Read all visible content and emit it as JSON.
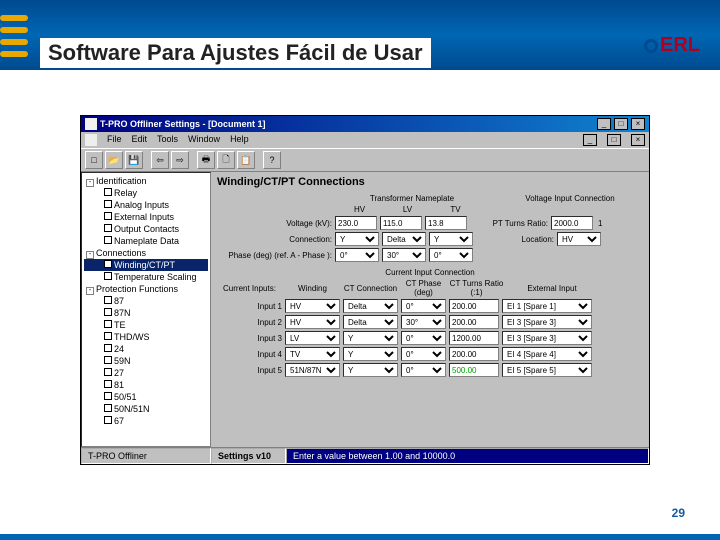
{
  "slide": {
    "title": "Software Para Ajustes Fácil de Usar",
    "page_number": "29",
    "logo": "ERL"
  },
  "window": {
    "title": "T-PRO Offliner Settings - [Document 1]",
    "menus": [
      "File",
      "Edit",
      "Tools",
      "Window",
      "Help"
    ],
    "toolbar_icons": [
      "new",
      "open",
      "save",
      "sep",
      "print",
      "copy",
      "paste",
      "sep2",
      "help"
    ]
  },
  "tree": {
    "items": [
      {
        "level": 0,
        "expand": "-",
        "label": "Identification"
      },
      {
        "level": 1,
        "check": true,
        "label": "Relay"
      },
      {
        "level": 1,
        "check": true,
        "label": "Analog Inputs"
      },
      {
        "level": 1,
        "check": true,
        "label": "External Inputs"
      },
      {
        "level": 1,
        "check": true,
        "label": "Output Contacts"
      },
      {
        "level": 1,
        "check": true,
        "label": "Nameplate Data"
      },
      {
        "level": 0,
        "expand": "-",
        "label": "Connections"
      },
      {
        "level": 1,
        "check": true,
        "selected": true,
        "label": "Winding/CT/PT"
      },
      {
        "level": 1,
        "check": true,
        "label": "Temperature Scaling"
      },
      {
        "level": 0,
        "expand": "-",
        "label": "Protection Functions"
      },
      {
        "level": 1,
        "check": true,
        "label": "87"
      },
      {
        "level": 1,
        "check": true,
        "label": "87N"
      },
      {
        "level": 1,
        "check": true,
        "label": "TE"
      },
      {
        "level": 1,
        "check": true,
        "label": "THD/WS"
      },
      {
        "level": 1,
        "check": true,
        "label": "24"
      },
      {
        "level": 1,
        "check": true,
        "label": "59N"
      },
      {
        "level": 1,
        "check": true,
        "label": "27"
      },
      {
        "level": 1,
        "check": true,
        "label": "81"
      },
      {
        "level": 1,
        "check": true,
        "label": "50/51"
      },
      {
        "level": 1,
        "check": true,
        "label": "50N/51N"
      },
      {
        "level": 1,
        "check": true,
        "label": "67"
      }
    ]
  },
  "panel": {
    "title": "Winding/CT/PT Connections",
    "transformer_label": "Transformer Nameplate",
    "voltage_input_label": "Voltage Input Connection",
    "cols": [
      "HV",
      "LV",
      "TV"
    ],
    "voltage_label": "Voltage (kV):",
    "voltage_vals": [
      "230.0",
      "115.0",
      "13.8"
    ],
    "pt_label": "PT Turns Ratio:",
    "pt_val": "2000.0",
    "pt_ratio": "1",
    "connection_label": "Connection:",
    "connection_vals": [
      "Y",
      "Delta",
      "Y"
    ],
    "location_label": "Location:",
    "location_val": "HV",
    "phase_label": "Phase (deg)\n(ref. A - Phase ):",
    "phase_vals": [
      "0°",
      "30°",
      "0°"
    ],
    "current_section": "Current Input Connection",
    "current_cols": [
      "Current Inputs:",
      "Winding",
      "CT Connection",
      "CT Phase (deg)",
      "CT Turns Ratio (:1)",
      "External Input"
    ],
    "current_rows": [
      {
        "label": "Input 1",
        "winding": "HV",
        "ct_conn": "Delta",
        "phase": "0°",
        "ratio": "200.00",
        "ext": "EI 1 [Spare 1]"
      },
      {
        "label": "Input 2",
        "winding": "HV",
        "ct_conn": "Delta",
        "phase": "30°",
        "ratio": "200.00",
        "ext": "EI 3 [Spare 3]"
      },
      {
        "label": "Input 3",
        "winding": "LV",
        "ct_conn": "Y",
        "phase": "0°",
        "ratio": "1200.00",
        "ext": "EI 3 [Spare 3]"
      },
      {
        "label": "Input 4",
        "winding": "TV",
        "ct_conn": "Y",
        "phase": "0°",
        "ratio": "200.00",
        "ext": "EI 4 [Spare 4]"
      },
      {
        "label": "Input 5",
        "winding": "51N/87N",
        "ct_conn": "Y",
        "phase": "0°",
        "ratio": "500.00",
        "ext": "EI 5 [Spare 5]",
        "highlight": true
      }
    ]
  },
  "status": {
    "left": "T-PRO Offliner",
    "mid": "Settings v10",
    "msg": "Enter a value between 1.00 and 10000.0"
  }
}
